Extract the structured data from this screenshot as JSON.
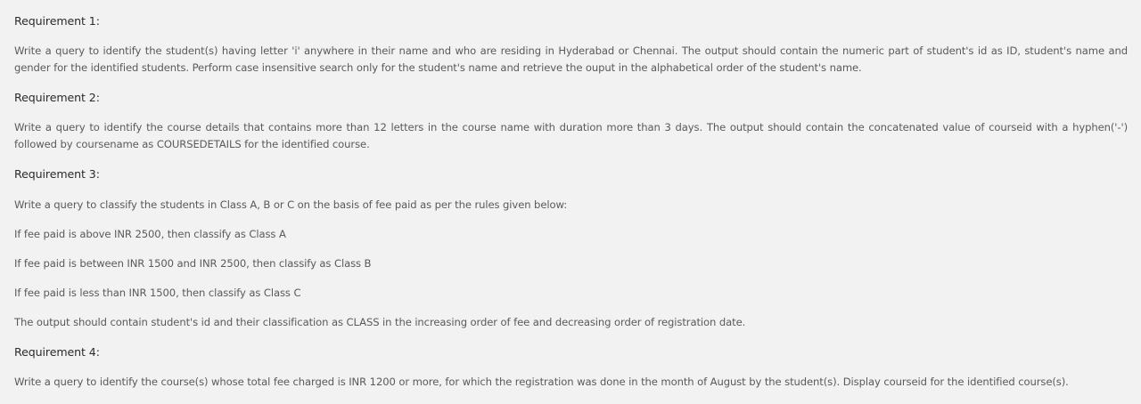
{
  "requirements": [
    {
      "title": "Requirement 1:",
      "text": "Write a query to identify the student(s)  having letter 'i' anywhere in their name  and who are residing in Hyderabad or Chennai. The output should contain the numeric part of student's id as ID, student's name and gender for the identified students. Perform case insensitive search only for the student's name and retrieve the ouput in the alphabetical order of the student's name."
    },
    {
      "title": "Requirement 2:",
      "text": "Write a query to identify the course details that contains more than 12 letters in the course name with duration more than 3 days. The output should contain the concatenated value of courseid with a hyphen('-') followed by coursename as COURSEDETAILS for the identified course."
    },
    {
      "title": "Requirement 3:",
      "intro": "Write a query to classify the students in Class A, B or C on the basis of fee paid as per the rules given below:",
      "rules": [
        "If fee paid is above INR 2500, then classify as Class A",
        "If fee paid is between INR 1500 and INR 2500, then classify as Class B",
        "If fee paid is less than INR 1500, then classify as Class C"
      ],
      "output": "The output should contain student's id and their classification as CLASS in the increasing order of fee and decreasing order of registration date."
    },
    {
      "title": "Requirement 4:",
      "text": "Write a query to identify the course(s) whose total fee charged is INR 1200 or more, for which the registration was done in the month of August by the student(s). Display courseid for the identified course(s)."
    }
  ]
}
